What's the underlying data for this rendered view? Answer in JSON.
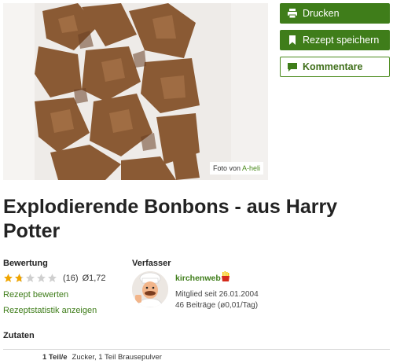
{
  "photo": {
    "credit_prefix": "Foto von ",
    "credit_author": "A-heli"
  },
  "actions": {
    "print": "Drucken",
    "save": "Rezept speichern",
    "comments": "Kommentare"
  },
  "recipe": {
    "title": "Explodierende Bonbons - aus Harry Potter"
  },
  "rating": {
    "heading": "Bewertung",
    "stars_value": 1.72,
    "stars_max": 5,
    "count": "(16)",
    "average": "Ø1,72",
    "rate_link": "Rezept bewerten",
    "stats_link": "Rezeptstatistik anzeigen"
  },
  "author": {
    "heading": "Verfasser",
    "name": "kirchenweb",
    "member_since": "Mitglied seit 26.01.2004",
    "posts": "46 Beiträge (ø0,01/Tag)"
  },
  "ingredients": {
    "heading": "Zutaten",
    "items": [
      {
        "amount": "1 Teil/e",
        "name": "Zucker, 1 Teil Brausepulver"
      }
    ]
  },
  "colors": {
    "brand_green": "#3f7d1a",
    "star_gold": "#f0a500",
    "star_empty": "#cfcfcf"
  }
}
